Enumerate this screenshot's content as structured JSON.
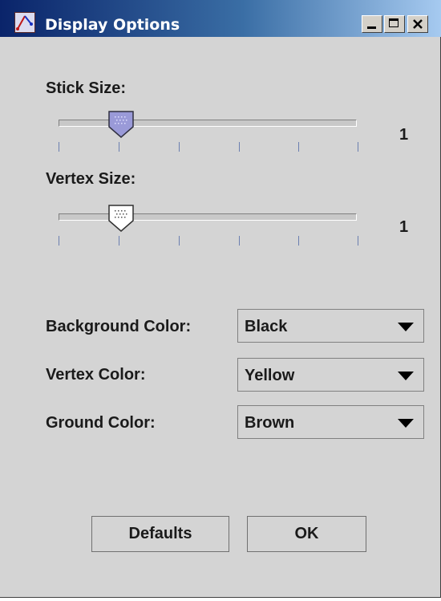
{
  "window": {
    "title": "Display Options"
  },
  "stick_size": {
    "label": "Stick Size:",
    "value_text": "1",
    "thumb_fraction": 0.21
  },
  "vertex_size": {
    "label": "Vertex Size:",
    "value_text": "1",
    "thumb_fraction": 0.21
  },
  "background_color": {
    "label": "Background Color:",
    "selected": "Black"
  },
  "vertex_color": {
    "label": "Vertex Color:",
    "selected": "Yellow"
  },
  "ground_color": {
    "label": "Ground Color:",
    "selected": "Brown"
  },
  "buttons": {
    "defaults": "Defaults",
    "ok": "OK"
  },
  "colors": {
    "stick_thumb": "#9a9ad8",
    "vertex_thumb": "#ffffff",
    "title_start": "#0a246a",
    "title_end": "#a6caf0"
  }
}
